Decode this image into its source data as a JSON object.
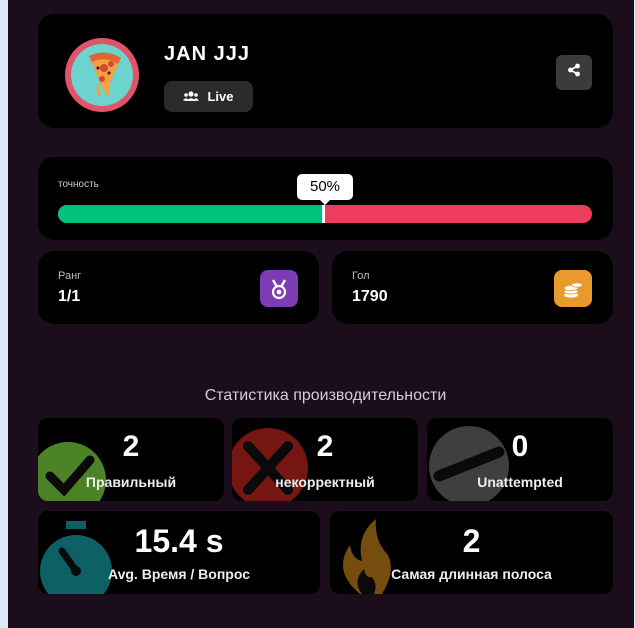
{
  "profile": {
    "name": "JAN JJJ",
    "mode_label": "Live",
    "avatar_icon": "pizza-icon",
    "share_icon": "share-icon"
  },
  "accuracy": {
    "label": "точность",
    "value_text": "50%",
    "fraction": 0.5,
    "correct_color": "#00c17e",
    "incorrect_color": "#ee3c5f"
  },
  "rank": {
    "label": "Ранг",
    "value": "1/1",
    "icon": "medal-icon",
    "icon_color": "#7d3cb5"
  },
  "goal": {
    "label": "Гол",
    "value": "1790",
    "icon": "coins-icon",
    "icon_color": "#e89a2c"
  },
  "performance": {
    "title": "Статистика производительности",
    "correct": {
      "value": "2",
      "label": "Правильный",
      "icon": "check-icon",
      "color": "#5a9a2e"
    },
    "incorrect": {
      "value": "2",
      "label": "некорректный",
      "icon": "cross-icon",
      "color": "#8a1a16"
    },
    "unattempted": {
      "value": "0",
      "label": "Unattempted",
      "icon": "minus-icon",
      "color": "#5a5a5a"
    },
    "avg_time": {
      "value": "15.4 s",
      "label": "Avg. Время / Вопрос",
      "icon": "stopwatch-icon",
      "color": "#0e6b70"
    },
    "streak": {
      "value": "2",
      "label": "Самая длинная полоса",
      "icon": "fire-icon",
      "color": "#8a5a10"
    }
  }
}
